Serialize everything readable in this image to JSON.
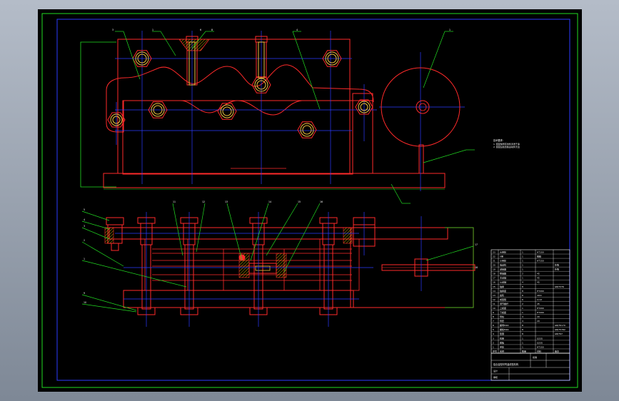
{
  "drawing": {
    "background": "#000000",
    "colors": {
      "part_outline": "#ff2a2a",
      "center_line": "#2b3bff",
      "leader": "#22dd22",
      "text": "#ffffff",
      "hatch": "#e8d000",
      "gear": "#f0c040",
      "frame": "#22dd22"
    },
    "notes": {
      "title": "技术要求:",
      "lines": [
        "1. 装配前所有零件清洗干净",
        "2. 装配后检查各运动件灵活"
      ]
    },
    "title_block": {
      "drawing_title": "铝合金型材弯曲成型机构",
      "labels": [
        "设计",
        "审核",
        "批准"
      ]
    },
    "parts_list": [
      {
        "no": "23",
        "name": "大带轮",
        "qty": "1",
        "material": "HT150",
        "note": ""
      },
      {
        "no": "22",
        "name": "V带",
        "qty": "1",
        "material": "橡胶",
        "note": ""
      },
      {
        "no": "21",
        "name": "小带轮",
        "qty": "1",
        "material": "HT150",
        "note": ""
      },
      {
        "no": "20",
        "name": "电动机",
        "qty": "1",
        "material": "",
        "note": "外购"
      },
      {
        "no": "19",
        "name": "减速器",
        "qty": "1",
        "material": "",
        "note": "外购"
      },
      {
        "no": "18",
        "name": "联轴器",
        "qty": "2",
        "material": "45",
        "note": ""
      },
      {
        "no": "17",
        "name": "主动轴",
        "qty": "1",
        "material": "45",
        "note": ""
      },
      {
        "no": "16",
        "name": "从动轴",
        "qty": "4",
        "material": "45",
        "note": ""
      },
      {
        "no": "15",
        "name": "轴承",
        "qty": "8",
        "material": "",
        "note": "GB/T276"
      },
      {
        "no": "14",
        "name": "轴承座",
        "qty": "8",
        "material": "HT200",
        "note": ""
      },
      {
        "no": "13",
        "name": "齿轮",
        "qty": "6",
        "material": "40Cr",
        "note": ""
      },
      {
        "no": "12",
        "name": "成型辊",
        "qty": "6",
        "material": "Cr12",
        "note": ""
      },
      {
        "no": "11",
        "name": "调节螺杆",
        "qty": "2",
        "material": "45",
        "note": ""
      },
      {
        "no": "10",
        "name": "上模座",
        "qty": "1",
        "material": "HT200",
        "note": ""
      },
      {
        "no": "9",
        "name": "下模座",
        "qty": "1",
        "material": "HT200",
        "note": ""
      },
      {
        "no": "8",
        "name": "导柱",
        "qty": "4",
        "material": "20",
        "note": ""
      },
      {
        "no": "7",
        "name": "导套",
        "qty": "4",
        "material": "20",
        "note": ""
      },
      {
        "no": "6",
        "name": "螺母M16",
        "qty": "8",
        "material": "",
        "note": "GB/T6170"
      },
      {
        "no": "5",
        "name": "螺栓M16",
        "qty": "8",
        "material": "",
        "note": "GB/T5782"
      },
      {
        "no": "4",
        "name": "垫圈",
        "qty": "8",
        "material": "",
        "note": "GB/T97"
      },
      {
        "no": "3",
        "name": "机架",
        "qty": "1",
        "material": "Q235",
        "note": ""
      },
      {
        "no": "2",
        "name": "底板",
        "qty": "1",
        "material": "Q235",
        "note": ""
      },
      {
        "no": "1",
        "name": "手轮",
        "qty": "1",
        "material": "HT150",
        "note": ""
      },
      {
        "no": "序号",
        "name": "名称",
        "qty": "数量",
        "material": "材料",
        "note": "备注"
      }
    ],
    "part_labels_top": [
      "3",
      "1",
      "6",
      "8",
      "4",
      "1"
    ],
    "part_labels_bottom": [
      "5",
      "4",
      "3",
      "2",
      "1",
      "9",
      "10",
      "11",
      "12",
      "13",
      "14",
      "15",
      "16",
      "17",
      "18"
    ]
  }
}
